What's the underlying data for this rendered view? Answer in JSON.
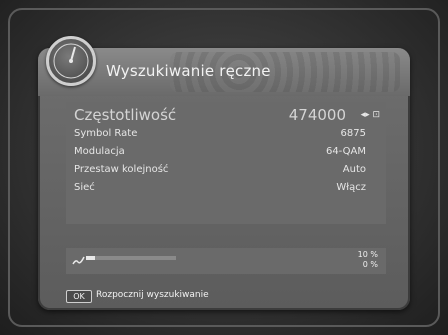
{
  "header": {
    "title": "Wyszukiwanie ręczne"
  },
  "settings": [
    {
      "label": "Częstotliwość",
      "value": "474000"
    },
    {
      "label": "Symbol Rate",
      "value": "6875"
    },
    {
      "label": "Modulacja",
      "value": "64-QAM"
    },
    {
      "label": "Przestaw kolejność",
      "value": "Auto"
    },
    {
      "label": "Sieć",
      "value": "Włącz"
    }
  ],
  "frequency_nav": "◂▸ ⊡",
  "progress": {
    "signal_fill": 0.1,
    "strength_text": "10 %",
    "quality_text": "0 %"
  },
  "footer": {
    "key_label": "OK",
    "action_label": "Rozpocznij wyszukiwanie"
  }
}
